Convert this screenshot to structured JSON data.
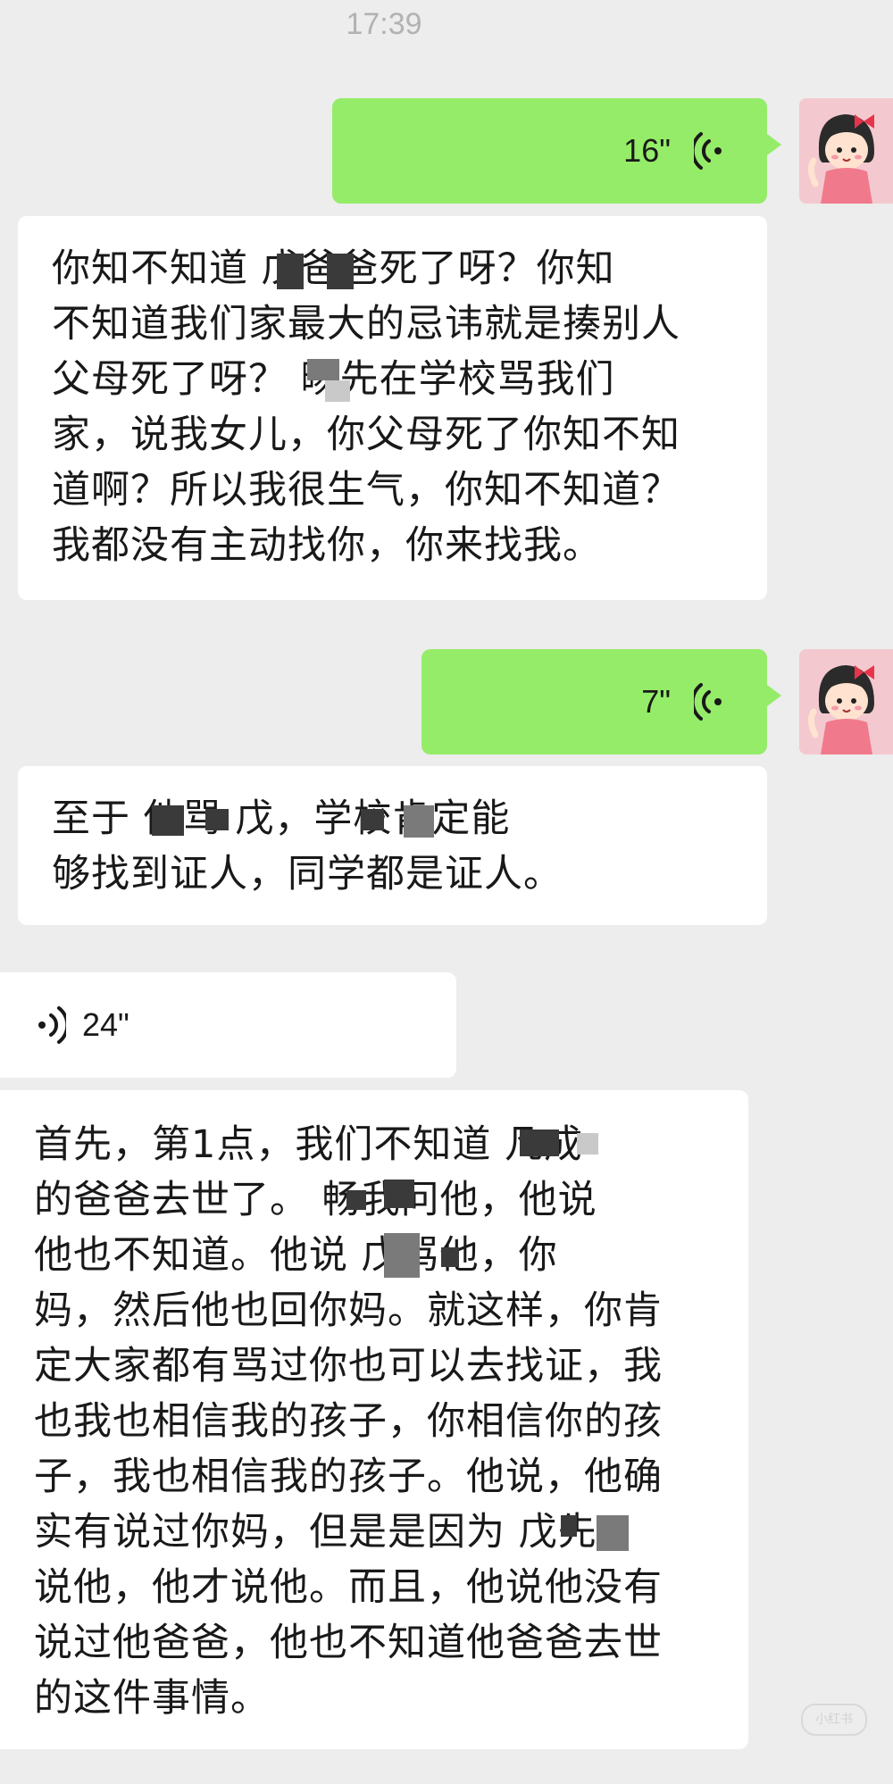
{
  "chat": {
    "timestamp": "17:39",
    "messages": [
      {
        "direction": "outgoing",
        "type": "voice",
        "duration": "16\""
      },
      {
        "direction": "incoming",
        "type": "text",
        "text": "你知不知道 戊爸爸死了呀？你知\n不知道我们家最大的忌讳就是揍别人\n父母死了呀？ 旸先在学校骂我们\n家，说我女儿，你父母死了你知不知\n道啊？所以我很生气，你知不知道？\n我都没有主动找你，你来找我。"
      },
      {
        "direction": "outgoing",
        "type": "voice",
        "duration": "7\""
      },
      {
        "direction": "incoming",
        "type": "text",
        "text": "至于 他骂 戊，学校肯定能\n够找到证人，同学都是证人。"
      },
      {
        "direction": "incoming",
        "type": "voice",
        "duration": "24\""
      },
      {
        "direction": "incoming",
        "type": "text",
        "text": "首先，第1点，我们不知道 凡成\n的爸爸去世了。 畅我问他，他说\n他也不知道。他说 戊骂他，你\n妈，然后他也回你妈。就这样，你肯\n定大家都有骂过你也可以去找证，我\n也我也相信我的孩子，你相信你的孩\n子，我也相信我的孩子。他说，他确\n实有说过你妈，但是是因为 戊先\n说他，他才说他。而且，他说他没有\n说过他爸爸，他也不知道他爸爸去世\n的这件事情。"
      }
    ]
  },
  "watermark": "小红书",
  "colors": {
    "background": "#ededed",
    "outgoing_bubble": "#95ec69",
    "incoming_bubble": "#ffffff",
    "timestamp": "#b2b2b2",
    "avatar_bg": "#f3c9cf"
  },
  "icons": {
    "voice": "voice-wave-icon",
    "avatar": "cartoon-girl-avatar"
  }
}
